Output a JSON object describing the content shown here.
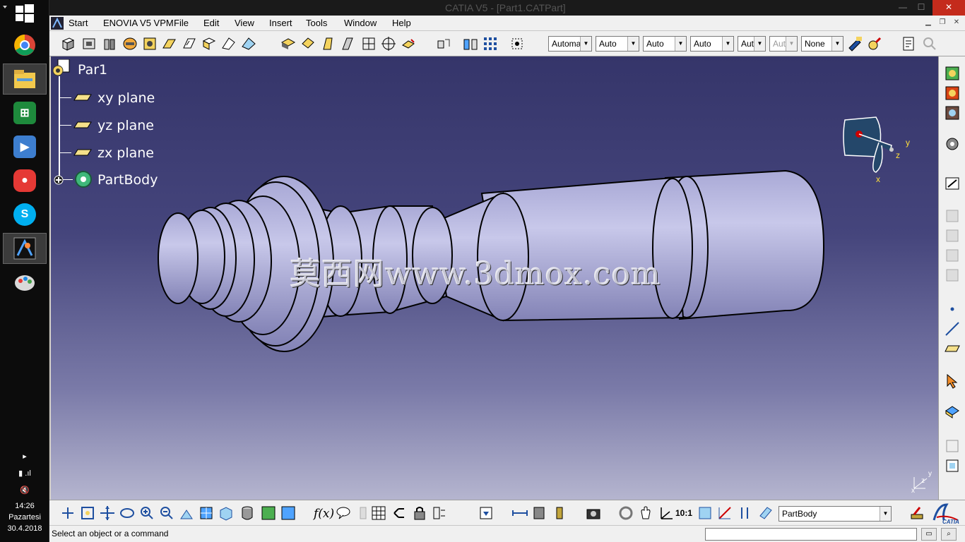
{
  "window": {
    "title": "CATIA V5 - [Part1.CATPart]",
    "minimize": "—",
    "maximize": "☐",
    "close": "✕"
  },
  "menubar": {
    "items": [
      "Start",
      "ENOVIA V5 VPM",
      "File",
      "Edit",
      "View",
      "Insert",
      "Tools",
      "Window",
      "Help"
    ]
  },
  "toolbar_top": {
    "combos": [
      {
        "value": "Automa",
        "disabled": false
      },
      {
        "value": "Auto",
        "disabled": false
      },
      {
        "value": "Auto",
        "disabled": false
      },
      {
        "value": "Auto",
        "disabled": false
      },
      {
        "value": "Aut",
        "disabled": false
      },
      {
        "value": "Aut",
        "disabled": true
      },
      {
        "value": "None",
        "disabled": false
      }
    ]
  },
  "spec_tree": {
    "root": "Par1",
    "children": [
      "xy plane",
      "yz plane",
      "zx plane",
      "PartBody"
    ]
  },
  "compass": {
    "axis_x": "x",
    "axis_y": "y",
    "axis_z": "z"
  },
  "mini_axis": {
    "x": "x",
    "y": "y",
    "z": "z"
  },
  "watermark": "莫西网www.3dmox.com",
  "toolbar_bottom": {
    "fx_label": "f(x)",
    "scale_label": "10:1",
    "body_combo": "PartBody"
  },
  "status": {
    "message": "Select an object or a command"
  },
  "taskbar": {
    "time": "14:26",
    "day": "Pazartesi",
    "date": "30.4.2018",
    "apps": [
      "chrome-icon",
      "file-explorer-icon",
      "store-icon",
      "media-player-icon",
      "screen-recorder-icon",
      "skype-icon",
      "catia-icon",
      "paint-icon"
    ]
  },
  "colors": {
    "viewport_top": "#35356a",
    "viewport_bottom": "#b5b5cf",
    "part_fill": "#b9b9dc",
    "close_red": "#c42b1c"
  }
}
